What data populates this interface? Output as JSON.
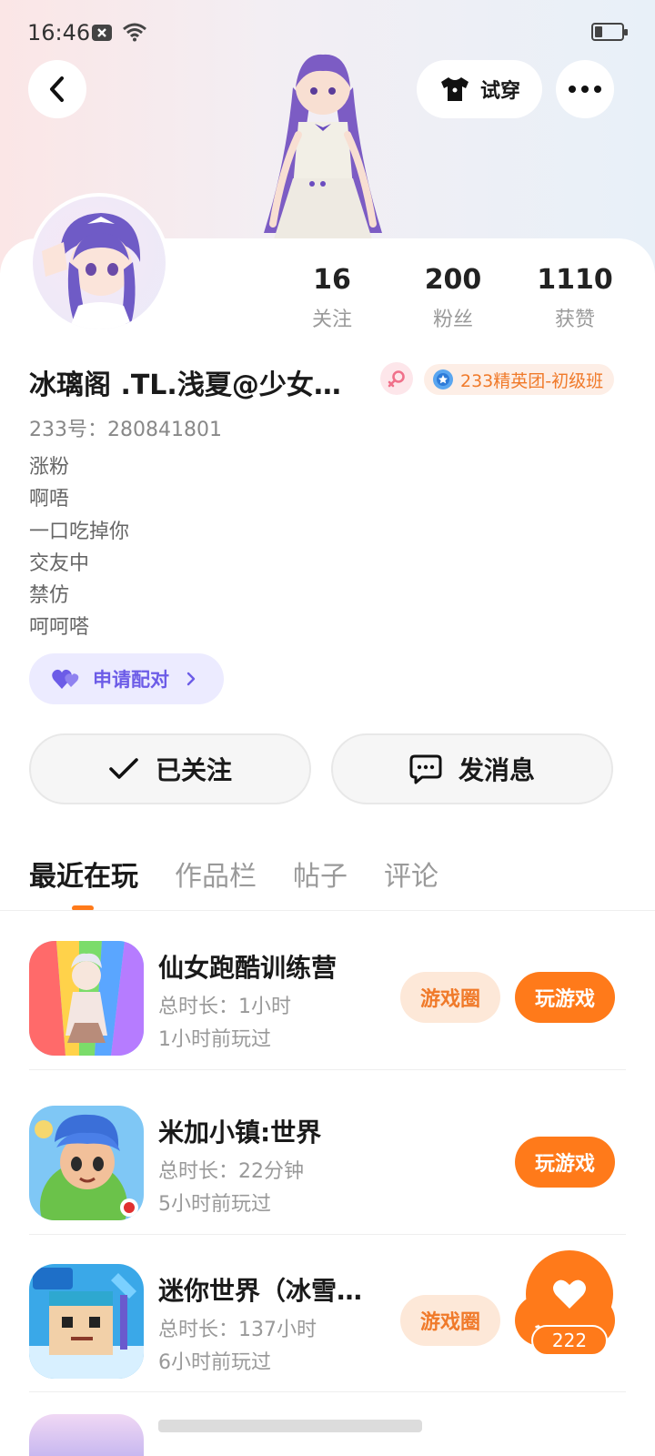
{
  "status_bar": {
    "time": "16:46"
  },
  "header": {
    "tryon_label": "试穿"
  },
  "stats": [
    {
      "num": "16",
      "label": "关注"
    },
    {
      "num": "200",
      "label": "粉丝"
    },
    {
      "num": "1110",
      "label": "获赞"
    }
  ],
  "profile": {
    "nickname": "冰璃阁 .TL.浅夏@少女心...",
    "level_badge": "233精英团-初级班",
    "uid": "233号：280841801",
    "bio": [
      "涨粉",
      "啊唔",
      "一口吃掉你",
      "交友中",
      "禁仿",
      "呵呵嗒"
    ],
    "pair_label": "申请配对"
  },
  "actions": {
    "follow_label": "已关注",
    "message_label": "发消息"
  },
  "tabs": [
    "最近在玩",
    "作品栏",
    "帖子",
    "评论"
  ],
  "games": [
    {
      "name": "仙女跑酷训练营",
      "duration": "总时长：1小时",
      "last_played": "1小时前玩过",
      "circle_label": "游戏圈",
      "play_label": "玩游戏"
    },
    {
      "name": "米加小镇:世界",
      "duration": "总时长：22分钟",
      "last_played": "5小时前玩过",
      "play_label": "玩游戏"
    },
    {
      "name": "迷你世界（冰雪奇...",
      "duration": "总时长：137小时",
      "last_played": "6小时前玩过",
      "circle_label": "游戏圈",
      "play_label": "玩游戏"
    }
  ],
  "floating_like": {
    "count": "222"
  },
  "colors": {
    "accent": "#ff7a1a",
    "pair_purple": "#6c5ce7"
  }
}
